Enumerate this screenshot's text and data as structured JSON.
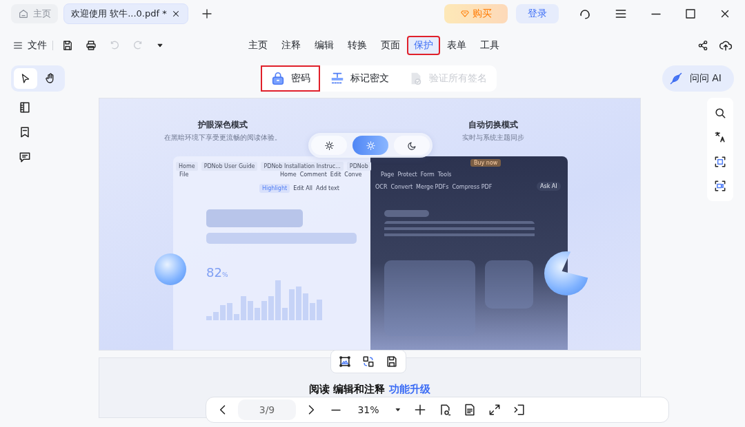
{
  "tabs": [
    {
      "kind": "home",
      "label": "主页",
      "selected": false
    },
    {
      "kind": "doc",
      "label": "欢迎使用 软牛...0.pdf *",
      "selected": true
    }
  ],
  "buy_button": "购买",
  "login_button": "登录",
  "toolbar": {
    "file": "文件",
    "history": [
      {
        "kind": "undo",
        "disabled": true
      },
      {
        "kind": "redo",
        "disabled": true
      }
    ]
  },
  "menu": [
    {
      "label": "主页",
      "selected": false,
      "highlighted": false
    },
    {
      "label": "注释",
      "selected": false,
      "highlighted": false
    },
    {
      "label": "编辑",
      "selected": false,
      "highlighted": false
    },
    {
      "label": "转换",
      "selected": false,
      "highlighted": false
    },
    {
      "label": "页面",
      "selected": false,
      "highlighted": false
    },
    {
      "label": "保护",
      "selected": true,
      "highlighted": true
    },
    {
      "label": "表单",
      "selected": false,
      "highlighted": false
    },
    {
      "label": "工具",
      "selected": false,
      "highlighted": false
    }
  ],
  "tool_modes": [
    {
      "kind": "select",
      "selected": true
    },
    {
      "kind": "hand",
      "selected": false
    }
  ],
  "protect_tools": [
    {
      "kind": "lock",
      "label": "密码",
      "disabled": false,
      "highlighted": true
    },
    {
      "kind": "redact",
      "label": "标记密文",
      "disabled": false,
      "highlighted": false
    },
    {
      "kind": "verify",
      "label": "验证所有签名",
      "disabled": true,
      "highlighted": false
    }
  ],
  "ask_ai": "问问 AI",
  "illustration": {
    "left_title": "护眼深色模式",
    "left_subtitle": "在黑暗环境下享受更流畅的阅读体验。",
    "right_title": "自动切换模式",
    "right_subtitle": "实时与系统主题同步",
    "stat": "82",
    "stat_unit": "%",
    "theme_modes": [
      {
        "kind": "light",
        "selected": false
      },
      {
        "kind": "auto",
        "selected": true
      },
      {
        "kind": "dark",
        "selected": false
      }
    ],
    "light_window": {
      "tabs": [
        "Home",
        "PDNob User Guide",
        "PDNob Installation Instruc...",
        "PDNob"
      ],
      "file": "File",
      "menu": [
        "Home",
        "Comment",
        "Edit",
        "Conve"
      ],
      "tools": [
        "Highlight",
        "Edit All",
        "Add text"
      ]
    },
    "dark_window": {
      "buy": "Buy now",
      "menu": [
        "Page",
        "Protect",
        "Form",
        "Tools"
      ],
      "tools": [
        "OCR",
        "Convert",
        "Merge PDFs",
        "Compress PDF"
      ],
      "ask_ai": "Ask AI"
    }
  },
  "page2": {
    "heading": "阅读 编辑和注释",
    "heading_highlight": "功能升级"
  },
  "page_nav": {
    "page": "3/9",
    "zoom": "31%"
  }
}
